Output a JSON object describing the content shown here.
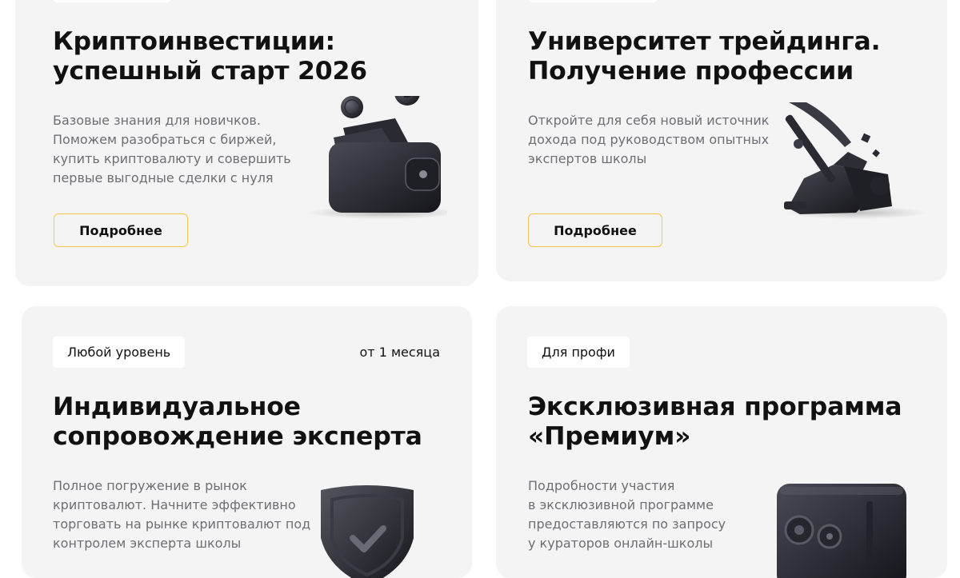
{
  "cards": [
    {
      "title_line1": "Криптоинвестиции:",
      "title_line2": "успешный старт 2026",
      "desc_lines": [
        "Базовые знания для новичков.",
        "Поможем разобраться с биржей,",
        "купить криптовалюту и совершить",
        "первые выгодные сделки с нуля"
      ],
      "button_label": "Подробнее",
      "illustration": "wallet-coins-icon"
    },
    {
      "title_line1": "Университет трейдинга.",
      "title_line2": "Получение профессии",
      "desc_lines": [
        "Откройте для себя новый источник",
        "дохода под руководством опытных",
        "экспертов школы"
      ],
      "button_label": "Подробнее",
      "illustration": "pickaxe-mining-icon"
    },
    {
      "tag": "Любой уровень",
      "duration": "от 1 месяца",
      "title_line1": "Индивидуальное",
      "title_line2": "сопровождение эксперта",
      "desc_lines": [
        "Полное погружение в рынок",
        "криптовалют. Начните эффективно",
        "торговать на рынке криптовалют под",
        "контролем эксперта школы"
      ],
      "illustration": "shield-check-icon"
    },
    {
      "tag": "Для профи",
      "title_line1": "Эксклюзивная программа",
      "title_line2": "«Премиум»",
      "desc_lines": [
        "Подробности участия",
        "в эксклюзивной программе",
        "предоставляются по запросу",
        "у кураторов онлайн-школы"
      ],
      "illustration": "safe-icon"
    }
  ],
  "colors": {
    "card_bg": "#f4f4f5",
    "button_border": "#f3c64f",
    "desc_text": "#6e6e73"
  }
}
